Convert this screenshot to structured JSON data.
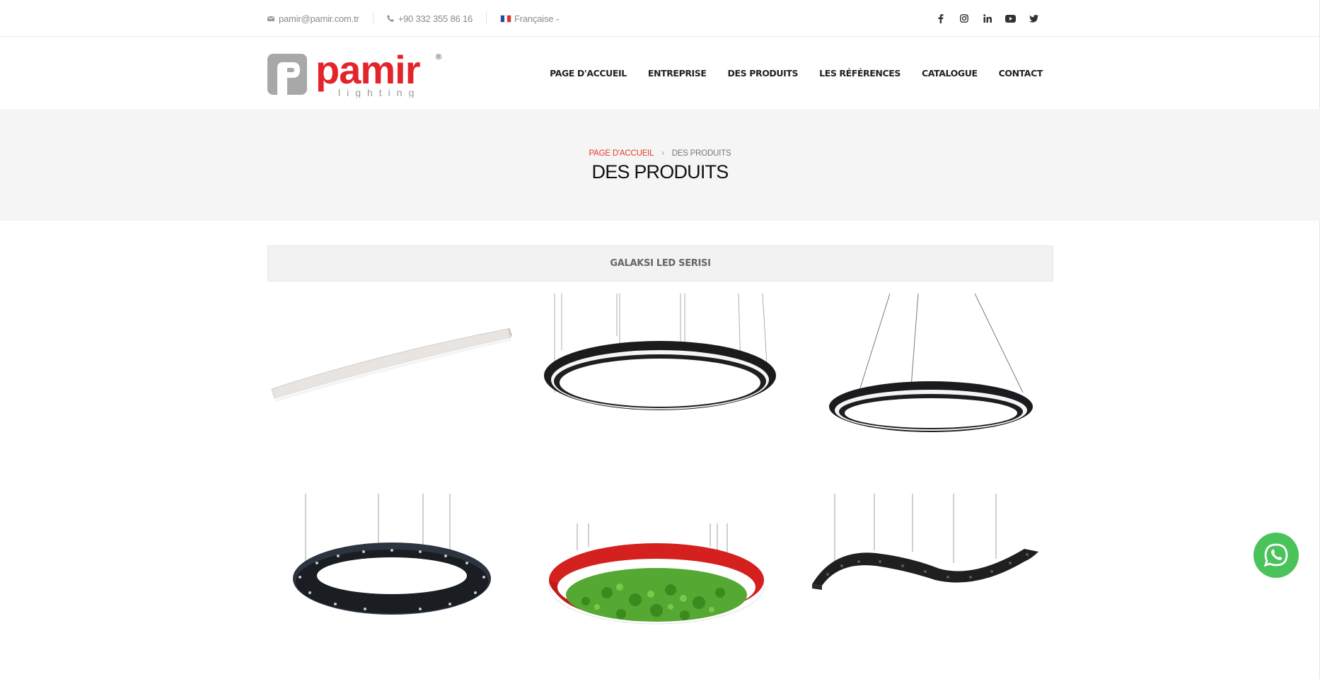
{
  "topbar": {
    "email": "pamir@pamir.com.tr",
    "phone": "+90 332 355 86 16",
    "language": "Française",
    "socials": [
      "facebook-icon",
      "instagram-icon",
      "linkedin-icon",
      "youtube-icon",
      "twitter-icon"
    ]
  },
  "brand": {
    "name": "pamir",
    "tagline": "lighting",
    "registered": "®",
    "color": "#e3242b"
  },
  "nav": {
    "items": [
      {
        "label": "PAGE D'ACCUEIL"
      },
      {
        "label": "ENTREPRISE"
      },
      {
        "label": "DES PRODUITS"
      },
      {
        "label": "LES RÉFÉRENCES"
      },
      {
        "label": "CATALOGUE"
      },
      {
        "label": "CONTACT"
      }
    ]
  },
  "banner": {
    "breadcrumb_home": "PAGE D'ACCUEIL",
    "breadcrumb_current": "DES PRODUITS",
    "title": "DES PRODUITS"
  },
  "series": {
    "title": "GALAKSI LED SERISI"
  },
  "products": [
    {
      "kind": "curved-linear-white"
    },
    {
      "kind": "large-black-ring"
    },
    {
      "kind": "black-ring-hanging"
    },
    {
      "kind": "black-ring-spots"
    },
    {
      "kind": "red-ring-moss"
    },
    {
      "kind": "wave-black-spots"
    }
  ],
  "colors": {
    "accent": "#e23b2b",
    "whatsapp": "#4ac35a",
    "banner_bg": "#f5f5f5"
  }
}
